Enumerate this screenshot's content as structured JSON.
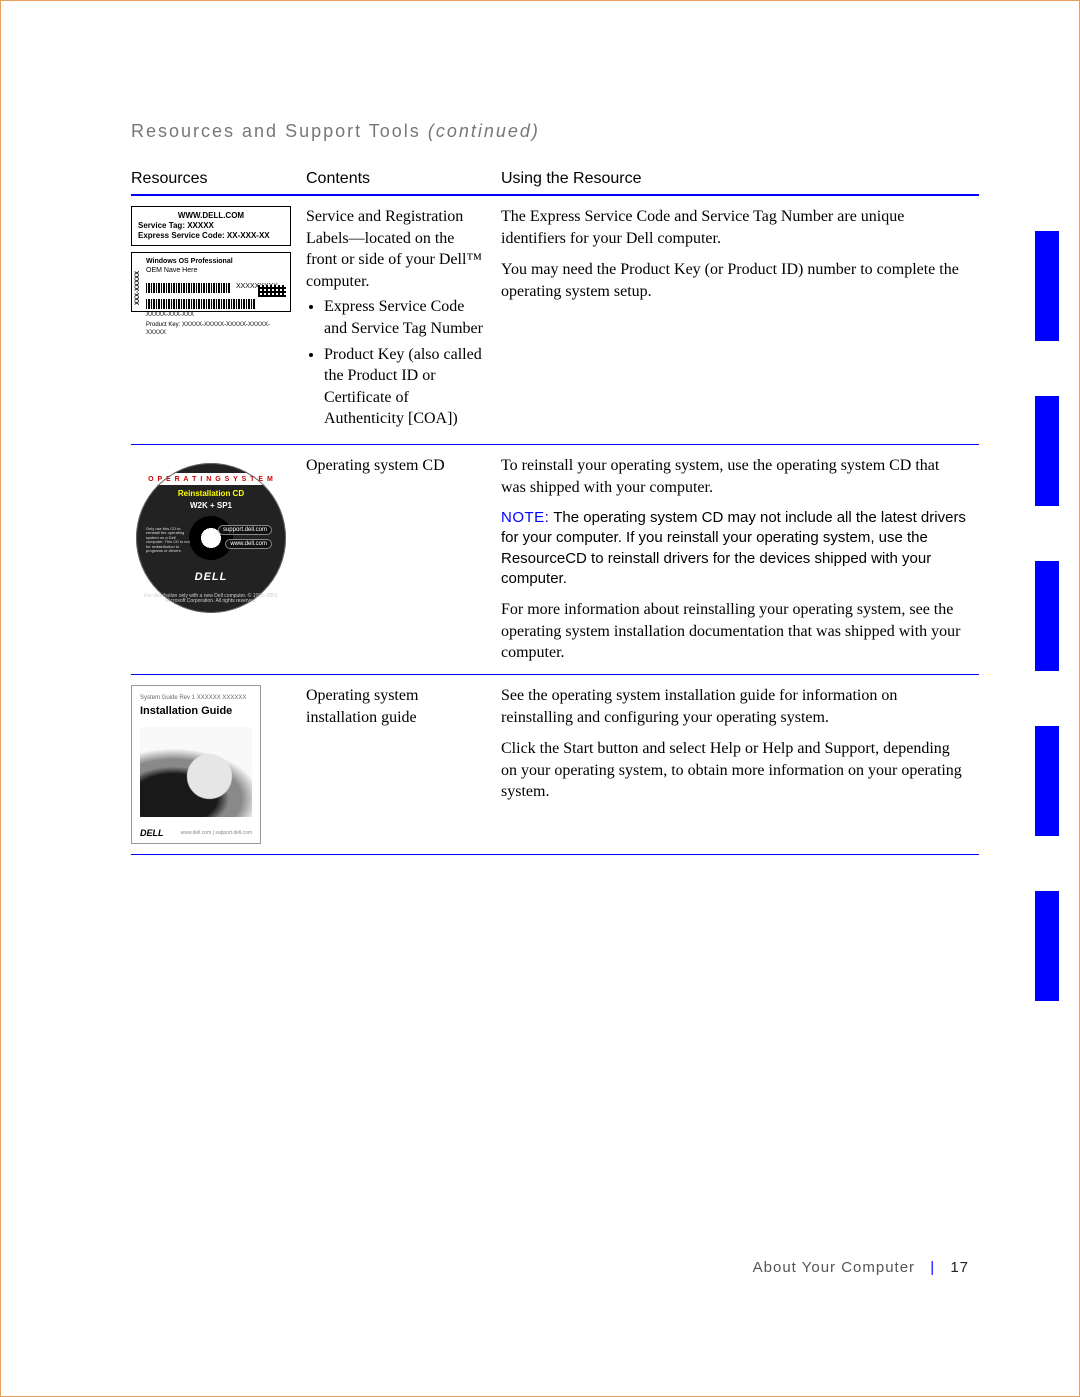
{
  "section_title_main": "Resources and Support Tools",
  "section_title_cont": "(continued)",
  "headers": {
    "resources": "Resources",
    "contents": "Contents",
    "using": "Using the Resource"
  },
  "rows": [
    {
      "contents_intro": "Service and Registration Labels—located on the front or side of your Dell™ computer.",
      "bullet1": "Express Service Code and Service Tag Number",
      "bullet2": "Product Key (also called the Product ID or Certificate of Authenticity [COA])",
      "using_p1": "The Express Service Code and Service Tag Number are unique identifiers for your Dell computer.",
      "using_p2": "You may need the Product Key (or Product ID) number to complete the operating system setup.",
      "label_top_l1": "WWW.DELL.COM",
      "label_top_l2": "Service Tag: XXXXX",
      "label_top_l3": "Express Service Code: XX-XXX-XX",
      "label_bot_os1": "Windows OS Professional",
      "label_bot_os2": "OEM Nave Here",
      "label_bot_xnum": "XXXXXXXXX",
      "label_bot_pk": "Product Key:  XXXXX-XXXXX-XXXXX-XXXXX-XXXXX",
      "label_bot_side": "XXX-XXXXX",
      "label_bot_sub": "XXXXX-XXX-XXX"
    },
    {
      "contents": "Operating system CD",
      "using_p1": "To reinstall your operating system, use the operating system CD that was shipped with your computer.",
      "note_label": "NOTE:",
      "note_body": "The operating system CD may not include all the latest drivers for your computer. If you reinstall your operating system, use the ResourceCD to reinstall drivers for the devices shipped with your computer.",
      "using_p3": "For more information about reinstalling your operating system, see the operating system installation documentation that was shipped with your computer.",
      "cd_topband": "O P E R A T I N G   S Y S T E M",
      "cd_reinst": "Reinstallation CD",
      "cd_ver": "W2K + SP1",
      "cd_pill1": "support.dell.com",
      "cd_pill2": "www.dell.com",
      "cd_dell": "DELL",
      "cd_small": "Only use this CD to reinstall the operating system on a Dell computer. This CD is not for redistribution to programs or drivers.",
      "cd_bot": "For distribution only with a new Dell computer.\n© 1995–2001 Microsoft Corporation. All rights reserved."
    },
    {
      "contents": "Operating system installation guide",
      "using_p1": "See the operating system installation guide for information on reinstalling and configuring your operating system.",
      "using_p2": "Click the Start button and select Help or Help and Support, depending on your operating system, to obtain more information on your operating system.",
      "guide_top": "System Guide   Rev 1   XXXXXX   XXXXXX",
      "guide_title": "Installation Guide",
      "guide_dell": "DELL",
      "guide_line": "www.dell.com  |  support.dell.com"
    }
  ],
  "footer": {
    "section": "About Your Computer",
    "page": "17"
  }
}
